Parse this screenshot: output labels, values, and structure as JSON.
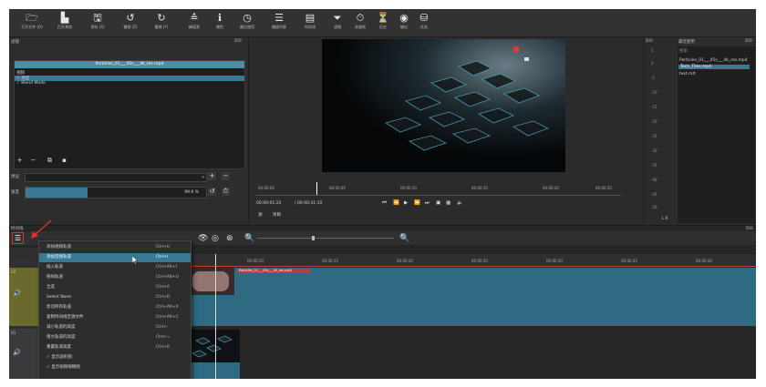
{
  "toolbar": {
    "items": [
      {
        "icon": "folder-icon",
        "label": "打开文件 (O)"
      },
      {
        "icon": "open-other-icon",
        "label": "打开其他"
      },
      {
        "icon": "save-icon",
        "label": "保存 (S)"
      },
      {
        "icon": "undo-icon",
        "label": "撤销 (Z)"
      },
      {
        "icon": "redo-icon",
        "label": "重做 (Y)"
      },
      {
        "icon": "peak-meter-icon",
        "label": "峰值表"
      },
      {
        "icon": "info-icon",
        "label": "属性"
      },
      {
        "icon": "history-icon",
        "label": "最近使用"
      },
      {
        "icon": "list-icon",
        "label": "播放列表"
      },
      {
        "icon": "timeline-icon",
        "label": "时间线"
      },
      {
        "icon": "filter-icon",
        "label": "滤镜"
      },
      {
        "icon": "keyframes-icon",
        "label": "关键帧"
      },
      {
        "icon": "history-clock-icon",
        "label": "历史"
      },
      {
        "icon": "export-icon",
        "label": "输出"
      },
      {
        "icon": "jobs-icon",
        "label": "任务"
      }
    ]
  },
  "filters": {
    "title": "滤镜",
    "clip_name": "Particles_01___45s___4k_res.mp4",
    "items": [
      "视频",
      "✓ 亮度",
      "✓ Blend Mode"
    ],
    "preset_label": "预设",
    "speed_label": "速度",
    "speed_value": "99.9 %"
  },
  "player": {
    "ruler_labels": [
      "00:00:00",
      "00:00:05",
      "00:00:10",
      "00:00:15",
      "00:00:20",
      "00:00:25",
      "00:00:30"
    ],
    "current_time": "00:00:01:22",
    "total_time": "/ 00:00:31:10",
    "source_label": "源",
    "project_label": "项目"
  },
  "meter": {
    "levels": [
      "5",
      "0",
      "-5",
      "-10",
      "-15",
      "-20",
      "-25",
      "-30",
      "-35",
      "-40",
      "-45",
      "-50"
    ],
    "channels": "L   R"
  },
  "playlist": {
    "title": "最近使用",
    "search_placeholder": "搜索",
    "items": [
      "Particles_01___45s___4k_res.mp4",
      "Tech_Tiles.mp4",
      "test.mlt"
    ]
  },
  "timeline": {
    "title": "时间线",
    "ruler_labels": [
      "00:00:10",
      "00:00:15",
      "00:00:20",
      "00:00:25",
      "00:00:30",
      "00:00:35",
      "00:00:40"
    ],
    "tracks": [
      {
        "num": "V2",
        "vol": "🔊"
      },
      {
        "num": "V1",
        "vol": "🔊"
      }
    ],
    "clip_title": "Particles_01___45s___4k_res.mp4"
  },
  "menu": {
    "items": [
      {
        "label": "添加视频轨道",
        "shortcut": "Ctrl+U"
      },
      {
        "label": "添加音频轨道",
        "shortcut": "Ctrl+I"
      },
      {
        "label": "插入轨道",
        "shortcut": "Ctrl+Alt+I"
      },
      {
        "label": "移除轨道",
        "shortcut": "Ctrl+Alt+U"
      },
      {
        "label": "全选",
        "shortcut": "Ctrl+A"
      },
      {
        "label": "Select None",
        "shortcut": "Ctrl+D"
      },
      {
        "label": "剪切所有轨道",
        "shortcut": "Ctrl+Alt+X"
      },
      {
        "label": "复制时间线至源文件",
        "shortcut": "Ctrl+Alt+C"
      },
      {
        "label": "减小轨道的高度",
        "shortcut": "Ctrl+-"
      },
      {
        "label": "增大轨道的高度",
        "shortcut": "Ctrl+="
      },
      {
        "label": "重置轨道高度",
        "shortcut": "Ctrl+0"
      },
      {
        "label": "✓  显示波形图",
        "shortcut": ""
      },
      {
        "label": "✓  显示视频缩略图",
        "shortcut": ""
      }
    ]
  }
}
